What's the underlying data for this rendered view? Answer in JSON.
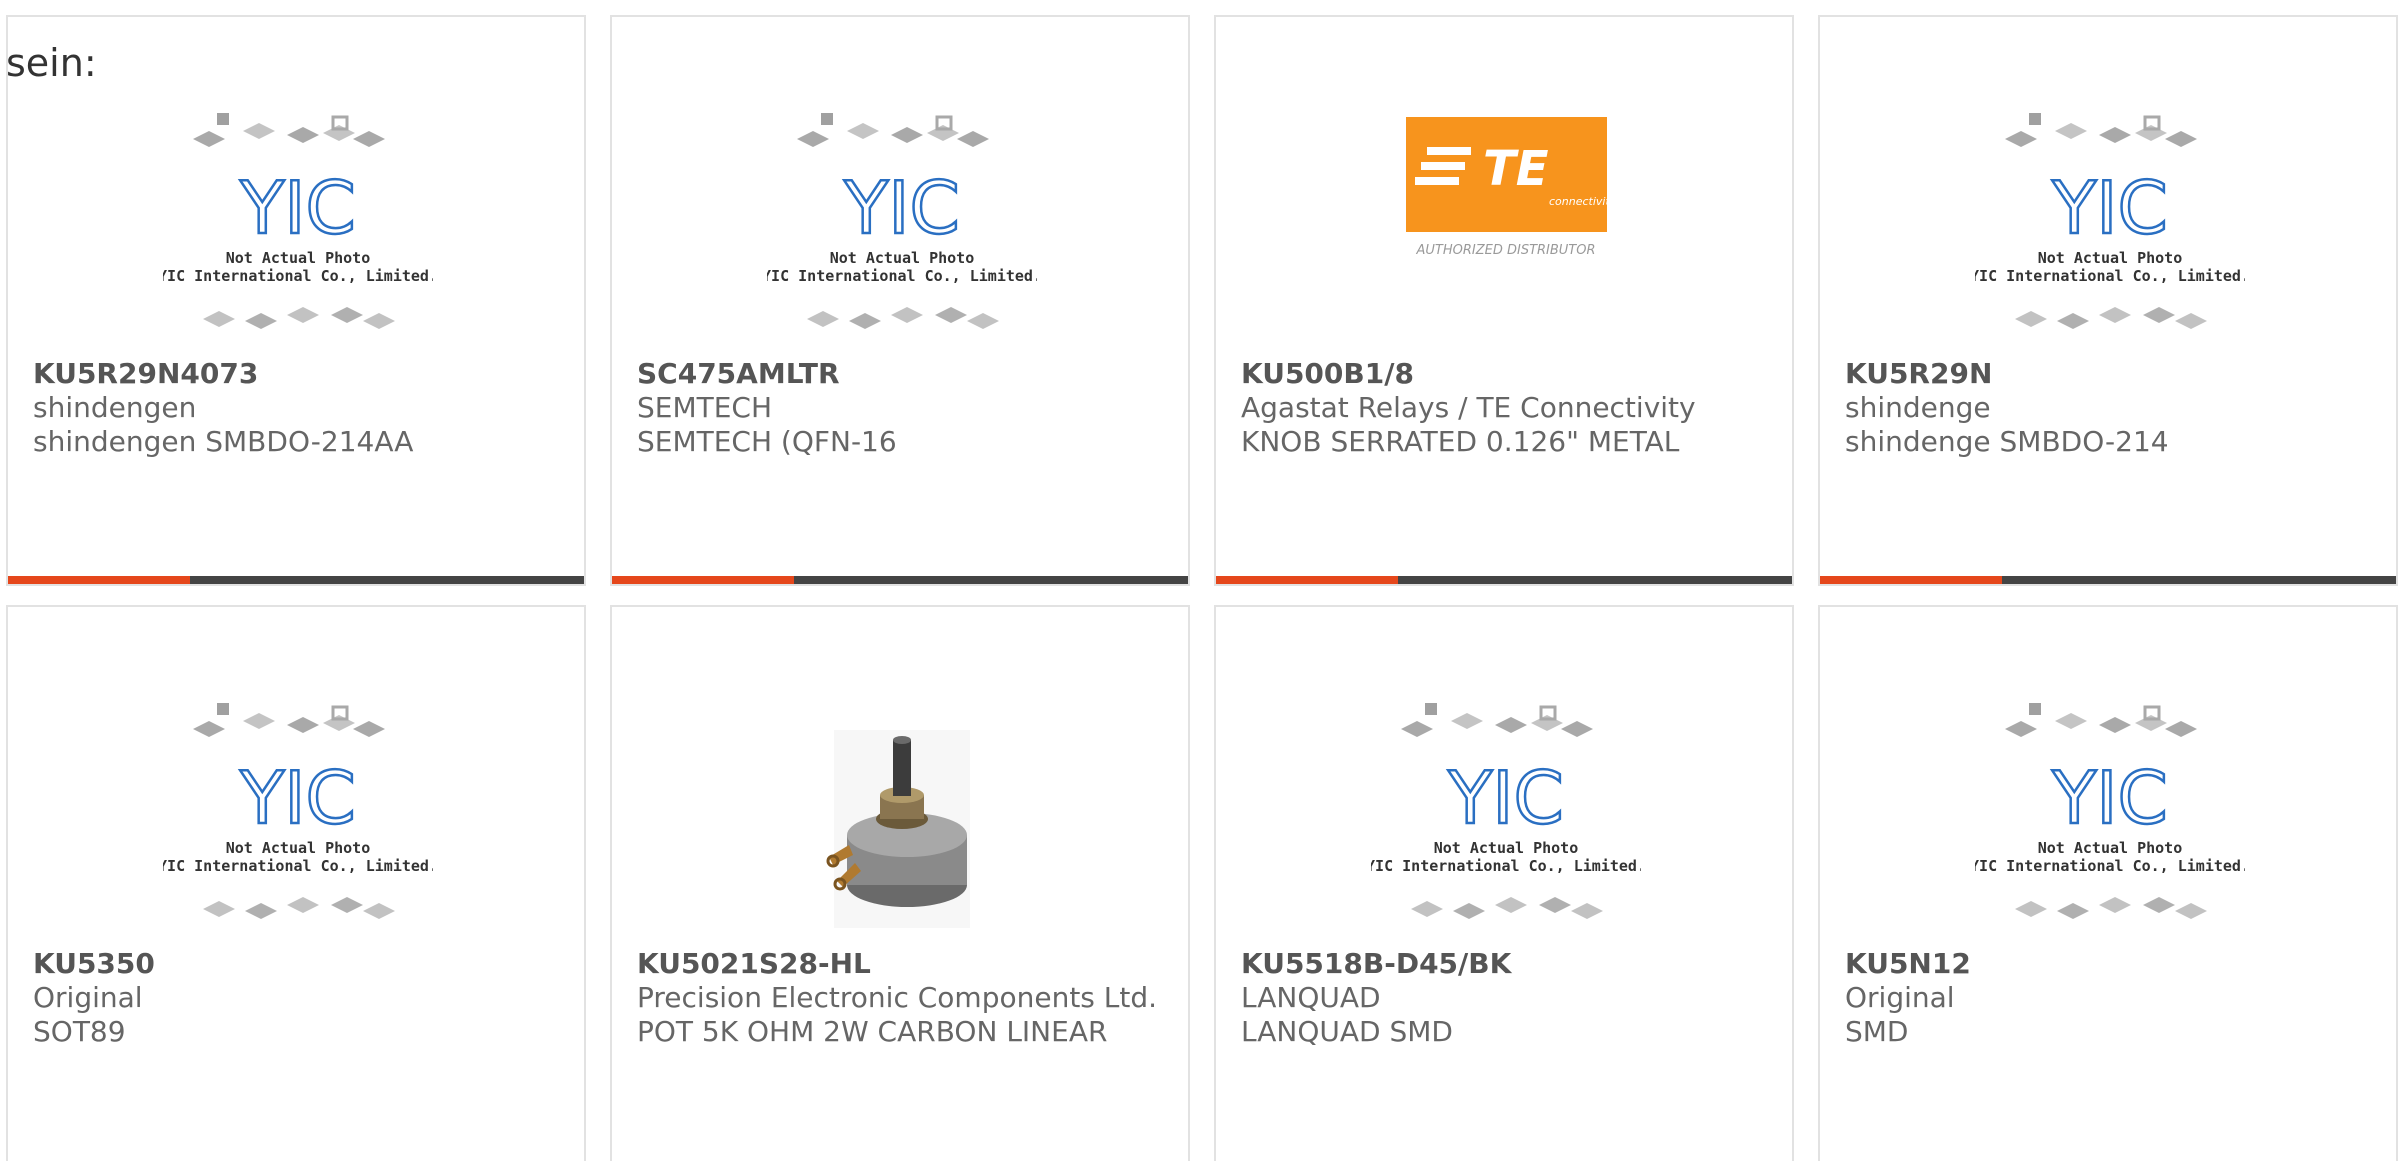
{
  "intro_text": "sein:",
  "colors": {
    "accent": "#e5471b",
    "bar": "#444444",
    "border": "#e2e2e2",
    "text": "#666666",
    "te_orange": "#f7941d",
    "yic_blue": "#2a6fc2"
  },
  "yic_placeholder": {
    "logo": "YIC",
    "line1": "Not Actual Photo",
    "line2": "YIC International Co., Limited."
  },
  "te_logo": {
    "brand": "TE",
    "sub": "connectivity",
    "caption": "AUTHORIZED DISTRIBUTOR"
  },
  "products": [
    {
      "part": "KU5R29N4073",
      "manufacturer": "shindengen",
      "description": "shindengen SMBDO-214AA",
      "image": "yic-placeholder"
    },
    {
      "part": "SC475AMLTR",
      "manufacturer": "SEMTECH",
      "description": "SEMTECH (QFN-16",
      "image": "yic-placeholder"
    },
    {
      "part": "KU500B1/8",
      "manufacturer": "Agastat Relays / TE Connectivity",
      "description": "KNOB SERRATED 0.126\" METAL",
      "image": "te-logo"
    },
    {
      "part": "KU5R29N",
      "manufacturer": "shindenge",
      "description": "shindenge SMBDO-214",
      "image": "yic-placeholder"
    },
    {
      "part": "KU5350",
      "manufacturer": "Original",
      "description": "SOT89",
      "image": "yic-placeholder"
    },
    {
      "part": "KU5021S28-HL",
      "manufacturer": "Precision Electronic Components Ltd.",
      "description": "POT 5K OHM 2W CARBON LINEAR",
      "image": "potentiometer-photo"
    },
    {
      "part": "KU5518B-D45/BK",
      "manufacturer": "LANQUAD",
      "description": "LANQUAD SMD",
      "image": "yic-placeholder"
    },
    {
      "part": "KU5N12",
      "manufacturer": "Original",
      "description": "SMD",
      "image": "yic-placeholder"
    }
  ]
}
